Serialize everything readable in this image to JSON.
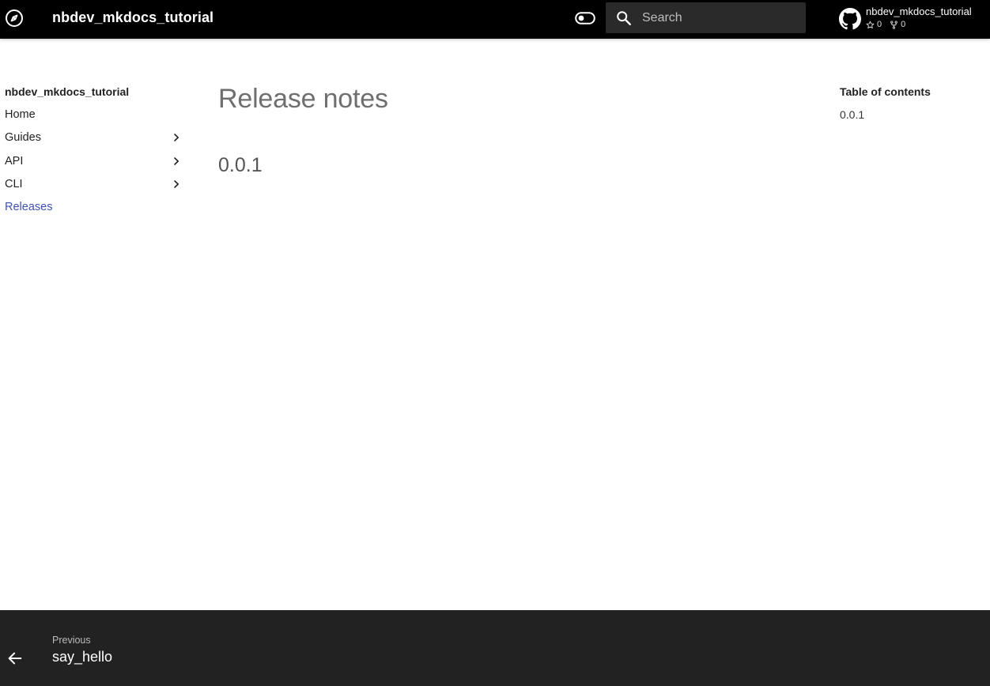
{
  "header": {
    "site_title": "nbdev_mkdocs_tutorial",
    "search": {
      "placeholder": "Search"
    },
    "repo": {
      "name": "nbdev_mkdocs_tutorial",
      "stars": "0",
      "forks": "0"
    }
  },
  "nav": {
    "title": "nbdev_mkdocs_tutorial",
    "items": [
      {
        "label": "Home",
        "expandable": false,
        "active": false
      },
      {
        "label": "Guides",
        "expandable": true,
        "active": false
      },
      {
        "label": "API",
        "expandable": true,
        "active": false
      },
      {
        "label": "CLI",
        "expandable": true,
        "active": false
      },
      {
        "label": "Releases",
        "expandable": false,
        "active": true
      }
    ]
  },
  "main": {
    "title": "Release notes",
    "section": "0.0.1"
  },
  "toc": {
    "title": "Table of contents",
    "items": [
      "0.0.1"
    ]
  },
  "footer": {
    "prev_direction": "Previous",
    "prev_title": "say_hello"
  },
  "colors": {
    "header_bg": "#000000",
    "footer_bg": "#222222",
    "active_link": "#3f51b5"
  },
  "icons": {
    "logo": "compass-icon",
    "palette": "toggle-icon",
    "search": "search-icon",
    "repo": "github-icon",
    "prev": "arrow-left-icon"
  }
}
